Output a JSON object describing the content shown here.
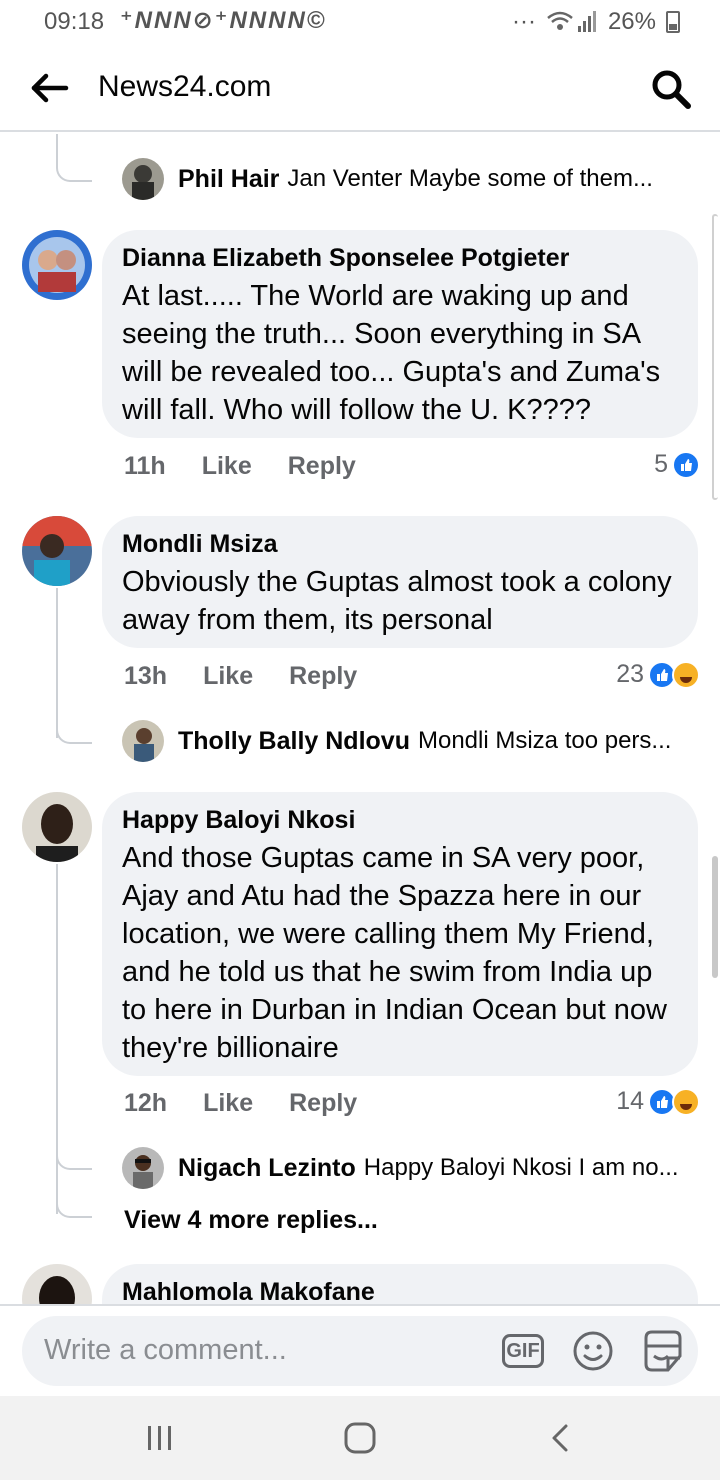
{
  "status_bar": {
    "time": "09:18",
    "notification_icons": "⁺NNN⊘⁺NNNN©",
    "more": "···",
    "battery": "26%"
  },
  "app_bar": {
    "title": "News24.com"
  },
  "comments": [
    {
      "reply_preview": {
        "author": "Phil Hair",
        "text": "Jan Venter  Maybe some of them..."
      }
    },
    {
      "author": "Dianna Elizabeth Sponselee Potgieter",
      "text": "At last..... The World are waking up and seeing the truth... Soon everything in SA will be revealed too... Gupta's and Zuma's will fall. Who will follow the U. K????",
      "time": "11h",
      "like_label": "Like",
      "reply_label": "Reply",
      "reaction_count": "5"
    },
    {
      "author": "Mondli Msiza",
      "text": "Obviously the Guptas almost took a colony away from them, its personal",
      "time": "13h",
      "like_label": "Like",
      "reply_label": "Reply",
      "reaction_count": "23",
      "reply_preview": {
        "author": "Tholly Bally Ndlovu",
        "text": "Mondli Msiza too pers..."
      }
    },
    {
      "author": "Happy Baloyi Nkosi",
      "text": "And those Guptas came in SA very poor, Ajay and Atu had the Spazza here in our location,  we were calling them My Friend,  and he told us that he swim from India up to here in Durban in Indian Ocean but now they're billionaire",
      "time": "12h",
      "like_label": "Like",
      "reply_label": "Reply",
      "reaction_count": "14",
      "reply_preview": {
        "author": "Nigach Lezinto",
        "text": "Happy Baloyi Nkosi I am no..."
      },
      "more_replies": "View 4 more replies..."
    },
    {
      "author": "Mahlomola Makofane"
    }
  ],
  "composer": {
    "placeholder": "Write a comment...",
    "gif_label": "GIF"
  },
  "colors": {
    "accent": "#1877f2",
    "bubble": "#f0f2f5",
    "secondary_text": "#65676b"
  }
}
